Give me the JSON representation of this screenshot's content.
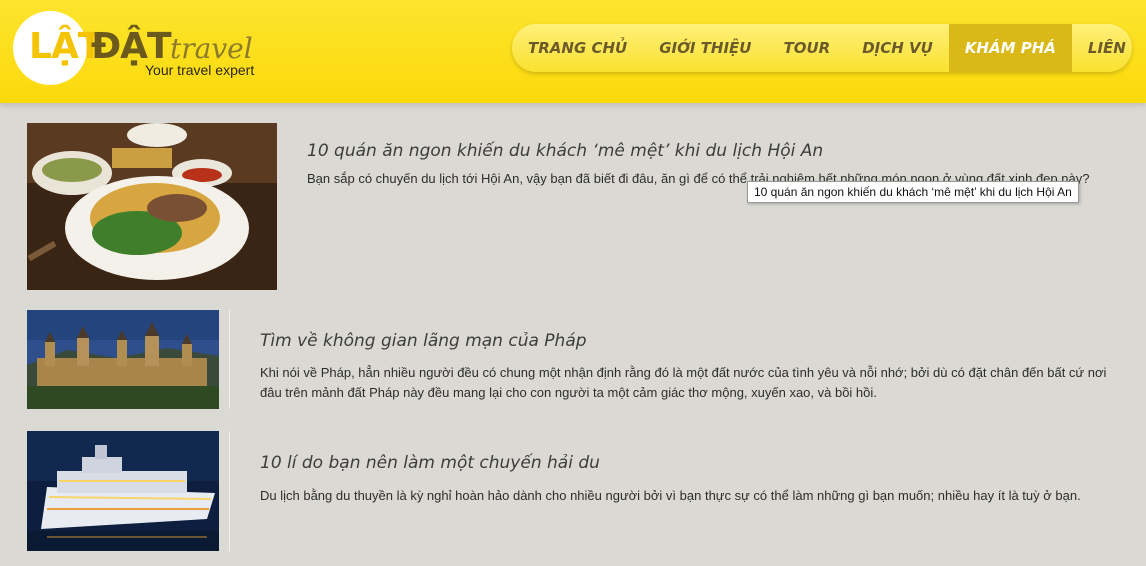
{
  "brand": {
    "logo_lat": "LẬT",
    "logo_dat": "ĐẬT",
    "logo_travel": "travel",
    "slogan": "Your travel expert"
  },
  "nav": {
    "items": [
      {
        "label": "TRANG CHỦ"
      },
      {
        "label": "GIỚI THIỆU"
      },
      {
        "label": "TOUR"
      },
      {
        "label": "DỊCH VỤ"
      },
      {
        "label": "KHÁM PHÁ"
      },
      {
        "label": "LIÊN HỆ"
      }
    ],
    "active": "KHÁM PHÁ"
  },
  "articles": [
    {
      "title": "10 quán ăn ngon khiến du khách ‘mê mệt’ khi du lịch Hội An",
      "description": "Bạn sắp có chuyến du lịch tới Hội An, vậy bạn đã biết đi đâu, ăn gì để có thể trải nghiệm hết những món ngon ở vùng đất xinh đẹp này?",
      "image": "food-photo"
    },
    {
      "title": "Tìm về không gian lãng mạn của Pháp",
      "description": "Khi nói về Pháp, hẳn nhiều người đều có chung một nhận định rằng đó là một đất nước của tình yêu và nỗi nhớ; bởi dù có đặt chân đến bất cứ nơi đâu trên mảnh đất Pháp này đều mang lại cho con người ta một cảm giác thơ mộng, xuyến xao, và bồi hồi.",
      "image": "castle-photo"
    },
    {
      "title": "10 lí do bạn nên làm một chuyến hải du",
      "description": "Du lịch bằng du thuyền là kỳ nghỉ hoàn hảo dành cho nhiều người bởi vì bạn thực sự có thể làm những gì bạn muốn; nhiều hay ít là tuỳ ở bạn.",
      "image": "cruise-ship-photo"
    }
  ],
  "tooltip": {
    "text": "10 quán ăn ngon khiến du khách ‘mê mệt’ khi du lịch Hội An"
  },
  "colors": {
    "header": "#fbd90b",
    "nav_active": "#d9b818",
    "background": "#dbd9d3"
  }
}
